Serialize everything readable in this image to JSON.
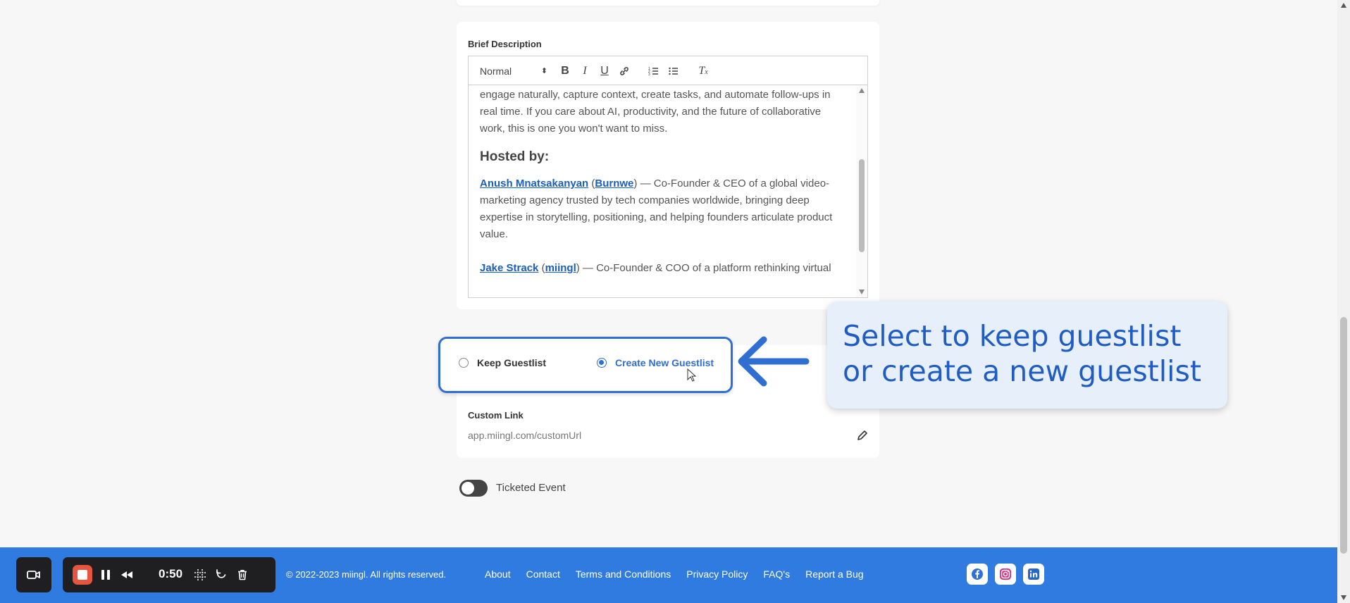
{
  "description": {
    "label": "Brief Description",
    "format_select": "Normal",
    "paragraph1": "engage naturally, capture context, create tasks, and automate follow-ups in real time. If you care about AI, productivity, and the future of collaborative work, this is one you won't want to miss.",
    "hosted_by_heading": "Hosted by:",
    "host1_name": "Anush Mnatsakanyan",
    "host1_company": "Burnwe",
    "host1_desc": " — Co-Founder & CEO of a global video-marketing agency trusted by tech companies worldwide, bringing deep expertise in storytelling, positioning, and helping founders articulate product value.",
    "host2_name": " Jake Strack",
    "host2_company": "miingl",
    "host2_desc": " — Co-Founder & COO of a platform rethinking virtual"
  },
  "guestlist": {
    "option1": "Keep Guestlist",
    "option2": "Create New Guestlist",
    "selected": "Create New Guestlist"
  },
  "custom_link": {
    "label": "Custom Link",
    "value": "app.miingl.com/customUrl"
  },
  "ticketed": {
    "label": "Ticketed Event",
    "enabled": false
  },
  "callout": {
    "text": "Select to keep guestlist or create a new guestlist",
    "color": "#1f5cc4"
  },
  "footer": {
    "copyright": "© 2022-2023 miingl. All rights reserved.",
    "links": [
      "About",
      "Contact",
      "Terms and Conditions",
      "Privacy Policy",
      "FAQ's",
      "Report a Bug"
    ],
    "socials": [
      "facebook-icon",
      "instagram-icon",
      "linkedin-icon"
    ],
    "color": "#2f7be0"
  },
  "recorder": {
    "time": "0:50"
  }
}
